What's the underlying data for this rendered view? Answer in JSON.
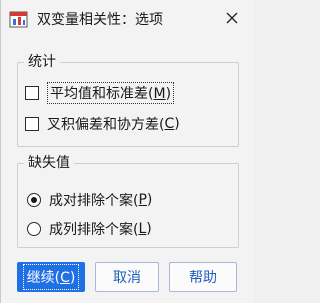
{
  "window": {
    "title": "双变量相关性：选项",
    "close_icon": "close-icon"
  },
  "statistics": {
    "legend": "统计",
    "means": {
      "label": "平均值和标准差(",
      "key": "M",
      "suffix": ")",
      "checked": false
    },
    "crossprod": {
      "label": "叉积偏差和协方差(",
      "key": "C",
      "suffix": ")",
      "checked": false
    }
  },
  "missing": {
    "legend": "缺失值",
    "pairwise": {
      "label": "成对排除个案(",
      "key": "P",
      "suffix": ")",
      "selected": true
    },
    "listwise": {
      "label": "成列排除个案(",
      "key": "L",
      "suffix": ")",
      "selected": false
    }
  },
  "buttons": {
    "continue": {
      "label": "继续(",
      "key": "C",
      "suffix": ")"
    },
    "cancel": "取消",
    "help": "帮助"
  },
  "colors": {
    "accent": "#1f6fe5",
    "button_text": "#1f5fbf"
  }
}
